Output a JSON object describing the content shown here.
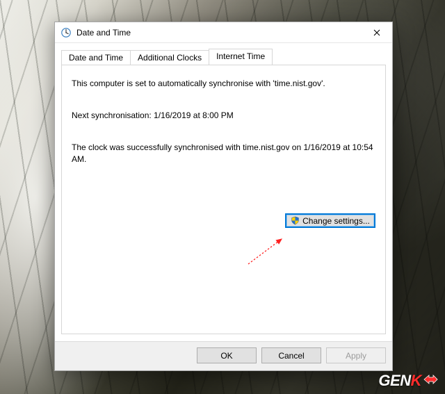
{
  "dialog": {
    "title": "Date and Time",
    "tabs": [
      {
        "label": "Date and Time"
      },
      {
        "label": "Additional Clocks"
      },
      {
        "label": "Internet Time"
      }
    ],
    "info_line1": "This computer is set to automatically synchronise with 'time.nist.gov'.",
    "next_sync": "Next synchronisation: 1/16/2019 at 8:00 PM",
    "sync_status": "The clock was successfully synchronised with time.nist.gov on 1/16/2019 at 10:54 AM.",
    "change_settings_label": "Change settings...",
    "buttons": {
      "ok": "OK",
      "cancel": "Cancel",
      "apply": "Apply"
    }
  },
  "watermark": "GENK"
}
